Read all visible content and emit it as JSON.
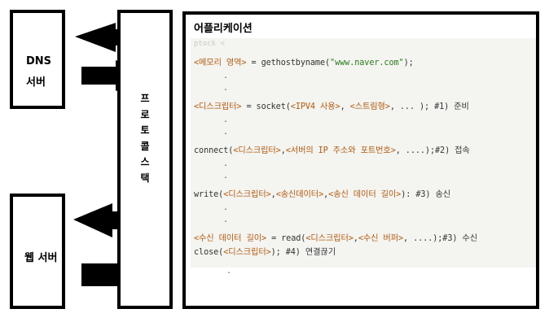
{
  "boxes": {
    "dns_line1": "DNS",
    "dns_line2": "서버",
    "web": "웹 서버",
    "protocol_chars": [
      "프",
      "로",
      "토",
      "콜",
      "스",
      "택"
    ],
    "app_title": "어플리케이션"
  },
  "code": {
    "faded_text": "ptock <",
    "line1": {
      "a": "<메모리 영역>",
      "b": " = gethostbyname(",
      "c": "\"www.naver.com\"",
      "d": ");"
    },
    "line2": {
      "a": "<디스크립터>",
      "b": " = socket(",
      "c": "<IPV4 사용>",
      "d": ", ",
      "e": "<스트림형>",
      "f": ", ... ); #1) 준비"
    },
    "line3": {
      "a": "connect(",
      "b": "<디스크립터>",
      "c": ",",
      "d": "<서버의 IP 주소와 포트번호>",
      "e": ", ....);#2) 접속"
    },
    "line4": {
      "a": "write(",
      "b": "<디스크립터>",
      "c": ",",
      "d": "<송신데이터>",
      "e": ",",
      "f": "<송신 데이터 길이>",
      "g": "): #3) 송신"
    },
    "line5": {
      "a": "<수신 데이터 길이>",
      "b": " = read(",
      "c": "<디스크립터>",
      "d": ",",
      "e": "<수신 버퍼>",
      "f": ", ....);#3) 수신"
    },
    "line6": {
      "a": "close(",
      "b": "<디스크립터>",
      "c": "); #4) 연결끊기"
    },
    "dot_char": "."
  },
  "colors": {
    "bracket": "#b05a10",
    "string": "#2d7a1f",
    "code_bg": "#f4f4f0"
  }
}
